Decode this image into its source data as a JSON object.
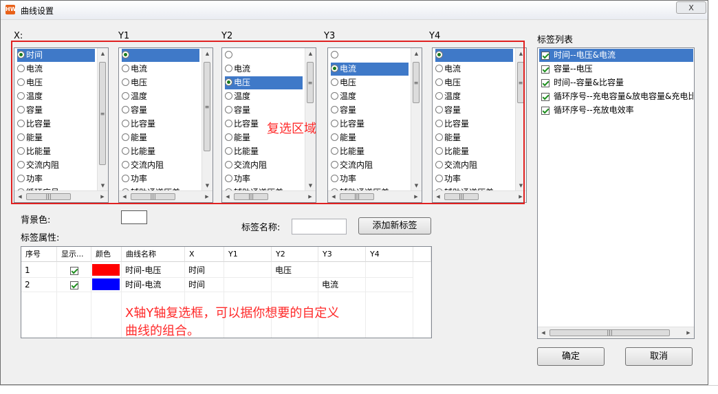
{
  "window": {
    "title": "曲线设置",
    "close_label": "X",
    "app_icon_text": "HW"
  },
  "axes": [
    {
      "label": "X:",
      "items": [
        "时间",
        "电流",
        "电压",
        "温度",
        "容量",
        "比容量",
        "能量",
        "比能量",
        "交流内阻",
        "功率",
        "循环序号"
      ],
      "selected": 0,
      "highlight": 0
    },
    {
      "label": "Y1",
      "items": [
        "",
        "电流",
        "电压",
        "温度",
        "容量",
        "比容量",
        "能量",
        "比能量",
        "交流内阻",
        "功率",
        "辅助通道压差"
      ],
      "selected": 0,
      "highlight": 0
    },
    {
      "label": "Y2",
      "items": [
        "",
        "电流",
        "电压",
        "温度",
        "容量",
        "比容量",
        "能量",
        "比能量",
        "交流内阻",
        "功率",
        "辅助通道压差"
      ],
      "selected": 2,
      "highlight": 2
    },
    {
      "label": "Y3",
      "items": [
        "",
        "电流",
        "电压",
        "温度",
        "容量",
        "比容量",
        "能量",
        "比能量",
        "交流内阻",
        "功率",
        "辅助通道压差"
      ],
      "selected": 1,
      "highlight": 1
    },
    {
      "label": "Y4",
      "items": [
        "",
        "电流",
        "电压",
        "温度",
        "容量",
        "比容量",
        "能量",
        "比能量",
        "交流内阻",
        "功率",
        "辅助通道压差"
      ],
      "selected": 0,
      "highlight": 0
    }
  ],
  "annotations": {
    "multi_select": "复选区域",
    "tip_line1": "X轴Y轴复选框，可以据你想要的自定义",
    "tip_line2": "曲线的组合。"
  },
  "form": {
    "bg_color_label": "背景色:",
    "tag_props_label": "标签属性:",
    "tag_name_label": "标签名称:",
    "tag_name_value": "",
    "add_tag_button": "添加新标签"
  },
  "table": {
    "headers": [
      "序号",
      "显示...",
      "颜色",
      "曲线名称",
      "X",
      "Y1",
      "Y2",
      "Y3",
      "Y4"
    ],
    "rows": [
      {
        "index": "1",
        "shown": true,
        "color": "#ff0000",
        "name": "时间-电压",
        "x": "时间",
        "y1": "",
        "y2": "电压",
        "y3": "",
        "y4": ""
      },
      {
        "index": "2",
        "shown": true,
        "color": "#0000ff",
        "name": "时间-电流",
        "x": "时间",
        "y1": "",
        "y2": "",
        "y3": "电流",
        "y4": ""
      }
    ]
  },
  "tag_list": {
    "title": "标签列表",
    "items": [
      {
        "label": "时间--电压&电流",
        "checked": true,
        "selected": true
      },
      {
        "label": "容量--电压",
        "checked": true,
        "selected": false
      },
      {
        "label": "时间--容量&比容量",
        "checked": true,
        "selected": false
      },
      {
        "label": "循环序号--充电容量&放电容量&充电比",
        "checked": true,
        "selected": false
      },
      {
        "label": "循环序号--充放电效率",
        "checked": true,
        "selected": false
      }
    ]
  },
  "buttons": {
    "ok": "确定",
    "cancel": "取消"
  },
  "colors": {
    "selection": "#3f79c8",
    "annotation": "#ff2a2a",
    "red_box": "#e02020"
  }
}
